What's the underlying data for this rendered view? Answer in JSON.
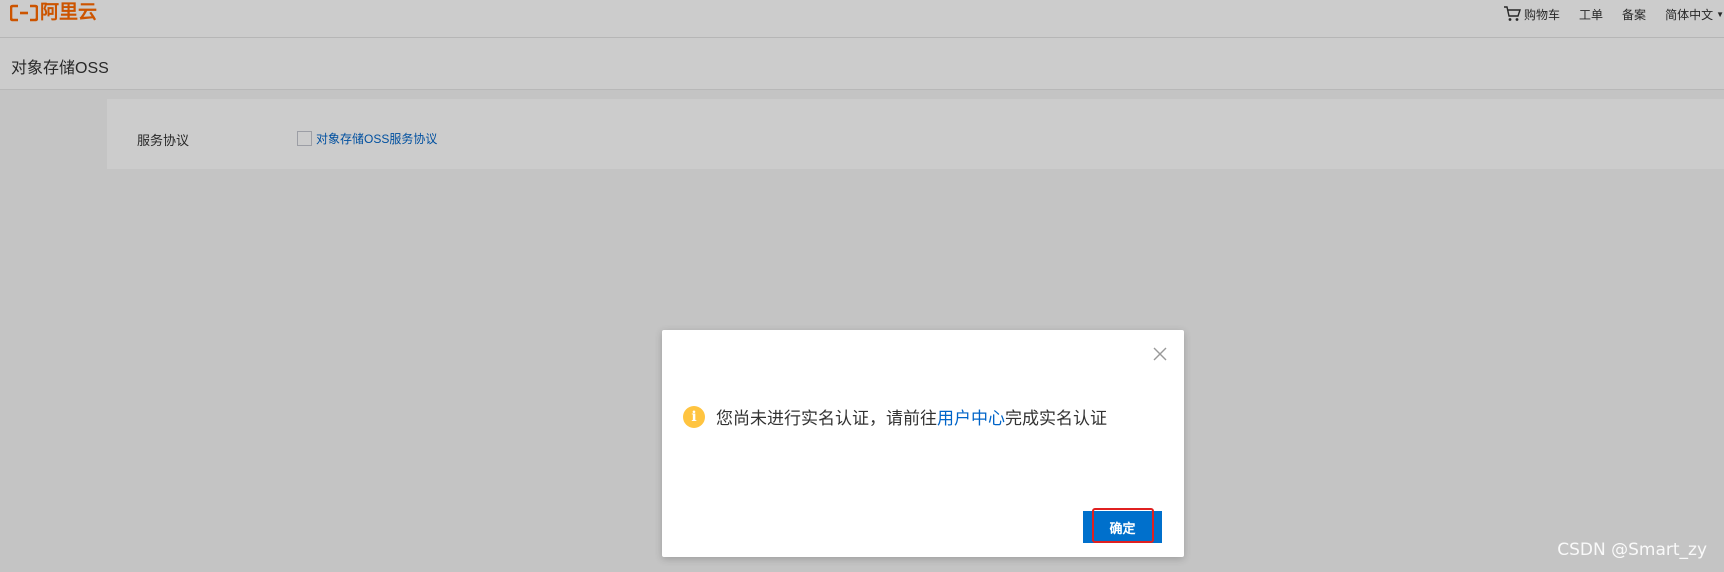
{
  "topbar": {
    "logo_text": "阿里云",
    "nav": {
      "cart_label": "购物车",
      "ticket_label": "工单",
      "filing_label": "备案",
      "language_label": "简体中文"
    }
  },
  "subheader": {
    "title": "对象存储OSS"
  },
  "panel": {
    "label": "服务协议",
    "agreement_link": "对象存储OSS服务协议",
    "agreement_checked": false
  },
  "dialog": {
    "message_before": "您尚未进行实名认证，请前往",
    "message_link": "用户中心",
    "message_after": "完成实名认证",
    "ok_label": "确定",
    "icon": "info-warning-icon"
  },
  "watermark": "CSDN @Smart_zy",
  "colors": {
    "brand": "#ff6a00",
    "link": "#0064c8",
    "primary_button": "#0070cc",
    "warning": "#ffc440",
    "highlight": "#e02020"
  }
}
